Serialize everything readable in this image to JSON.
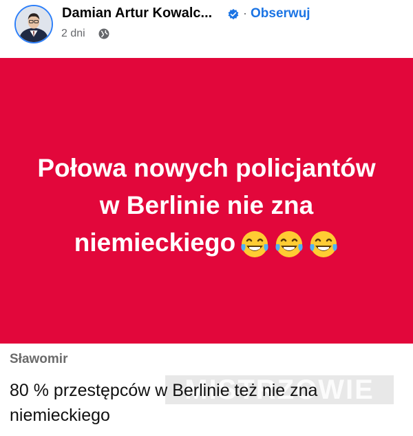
{
  "post": {
    "author": "Damian Artur Kowalc...",
    "separator": "·",
    "follow_label": "Obserwuj",
    "time": "2 dni"
  },
  "banner": {
    "headline": "Połowa nowych policjantów w Berlinie nie zna niemieckiego",
    "background_color": "#e2073b",
    "emoji_icons": [
      "face-with-tears-of-joy-icon",
      "face-with-tears-of-joy-icon",
      "face-with-tears-of-joy-icon"
    ]
  },
  "comment": {
    "author": "Sławomir",
    "text": "80 % przestępców w Berlinie też nie zna niemieckiego"
  },
  "watermark": {
    "text": "MISTRZOWIE"
  },
  "colors": {
    "accent": "#1b74e4",
    "verified": "#1b74e4"
  }
}
